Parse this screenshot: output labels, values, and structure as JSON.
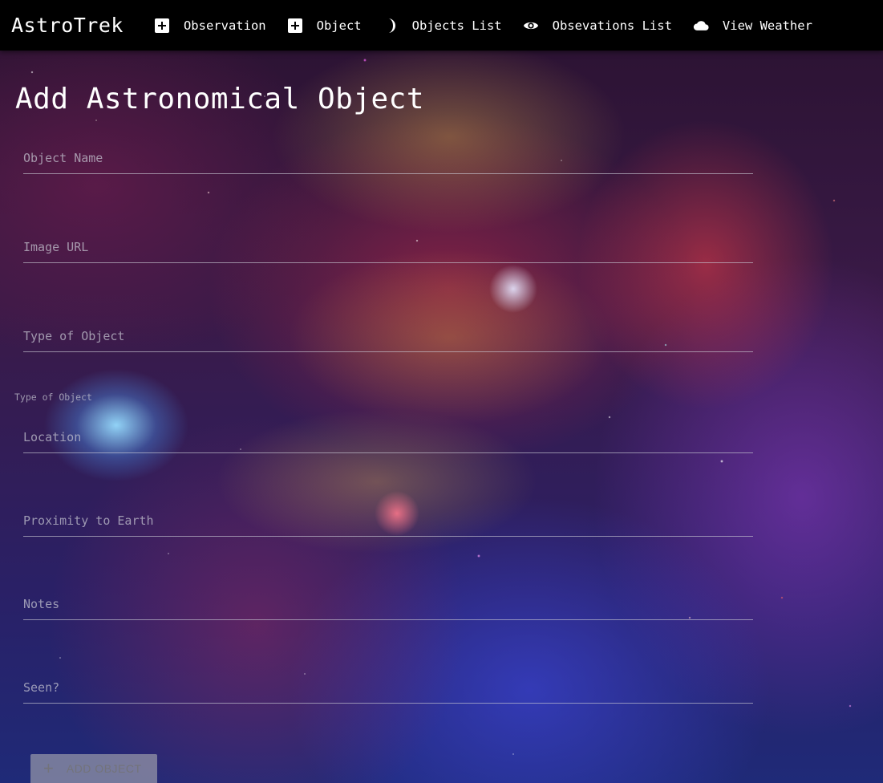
{
  "app": {
    "brand": "AstroTrek"
  },
  "nav": {
    "items": [
      {
        "label": "Observation",
        "icon": "plus-box-icon"
      },
      {
        "label": "Object",
        "icon": "plus-box-icon"
      },
      {
        "label": "Objects List",
        "icon": "moon-icon"
      },
      {
        "label": "Obsevations List",
        "icon": "eye-icon"
      },
      {
        "label": "View Weather",
        "icon": "cloud-icon"
      }
    ]
  },
  "form": {
    "title": "Add Astronomical Object",
    "fields": {
      "object_name": {
        "placeholder": "Object Name",
        "value": ""
      },
      "image_url": {
        "placeholder": "Image URL",
        "value": ""
      },
      "type_of_object": {
        "placeholder": "Type of Object",
        "value": ""
      },
      "type_select_label": "Type of Object",
      "location": {
        "placeholder": "Location",
        "value": ""
      },
      "proximity": {
        "placeholder": "Proximity to Earth",
        "value": ""
      },
      "notes": {
        "placeholder": "Notes",
        "value": ""
      },
      "seen": {
        "placeholder": "Seen?",
        "value": ""
      }
    },
    "submit": {
      "icon": "plus-icon",
      "icon_glyph": "+",
      "label": "ADD OBJECT"
    }
  },
  "colors": {
    "navbar_bg": "#000000",
    "text": "#ffffff",
    "placeholder": "#c8c8d2",
    "button_bg": "#afafb4"
  }
}
